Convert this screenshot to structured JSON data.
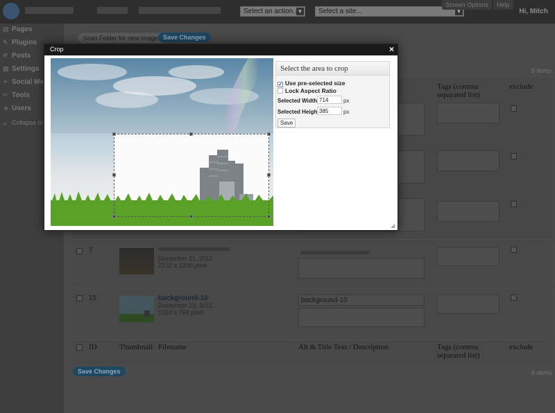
{
  "adminbar": {
    "action_select": "Select an action...",
    "site_select": "Select a site...",
    "screen_options": "Screen Options",
    "help": "Help",
    "greeting": "Hi, Mitch"
  },
  "sidebar": {
    "items": [
      {
        "label": "Pages",
        "icon": "pages-icon"
      },
      {
        "label": "Plugins",
        "icon": "plugins-icon"
      },
      {
        "label": "Posts",
        "icon": "posts-icon"
      },
      {
        "label": "Settings",
        "icon": "settings-icon"
      },
      {
        "label": "Social Me",
        "icon": "social-icon"
      },
      {
        "label": "Tools",
        "icon": "tools-icon"
      },
      {
        "label": "Users",
        "icon": "users-icon"
      },
      {
        "label": "Collapse m",
        "icon": "collapse-icon"
      }
    ]
  },
  "toolbar": {
    "scan_label": "Scan Folder for new images",
    "save_label": "Save Changes",
    "items_count": "5 items"
  },
  "table": {
    "headers": [
      "ID",
      "Thumbnail",
      "Filename",
      "Alt & Title Text / Description",
      "Tags (comma separated list)",
      "exclude"
    ],
    "rows": [
      {
        "id": "7",
        "filename": "",
        "date": "December 21, 2011",
        "dims": "2232 x 1200 pixel",
        "alt": ""
      },
      {
        "id": "15",
        "filename": "background-10",
        "date": "December 23, 2011",
        "dims": "1024 x 768 pixel",
        "alt": "background-10"
      }
    ],
    "bottom_save": "Save Changes",
    "bottom_count": "5 items"
  },
  "modal": {
    "title": "Crop",
    "close": "×",
    "panel_title": "Select the area to crop",
    "use_preselected": "Use pre-selected size",
    "use_preselected_checked": true,
    "lock_aspect": "Lock Aspect Ratio",
    "lock_aspect_checked": false,
    "width_label": "Selected Width",
    "width_value": "714",
    "height_label": "Selected Height",
    "height_value": "385",
    "unit": "px",
    "save_label": "Save"
  }
}
